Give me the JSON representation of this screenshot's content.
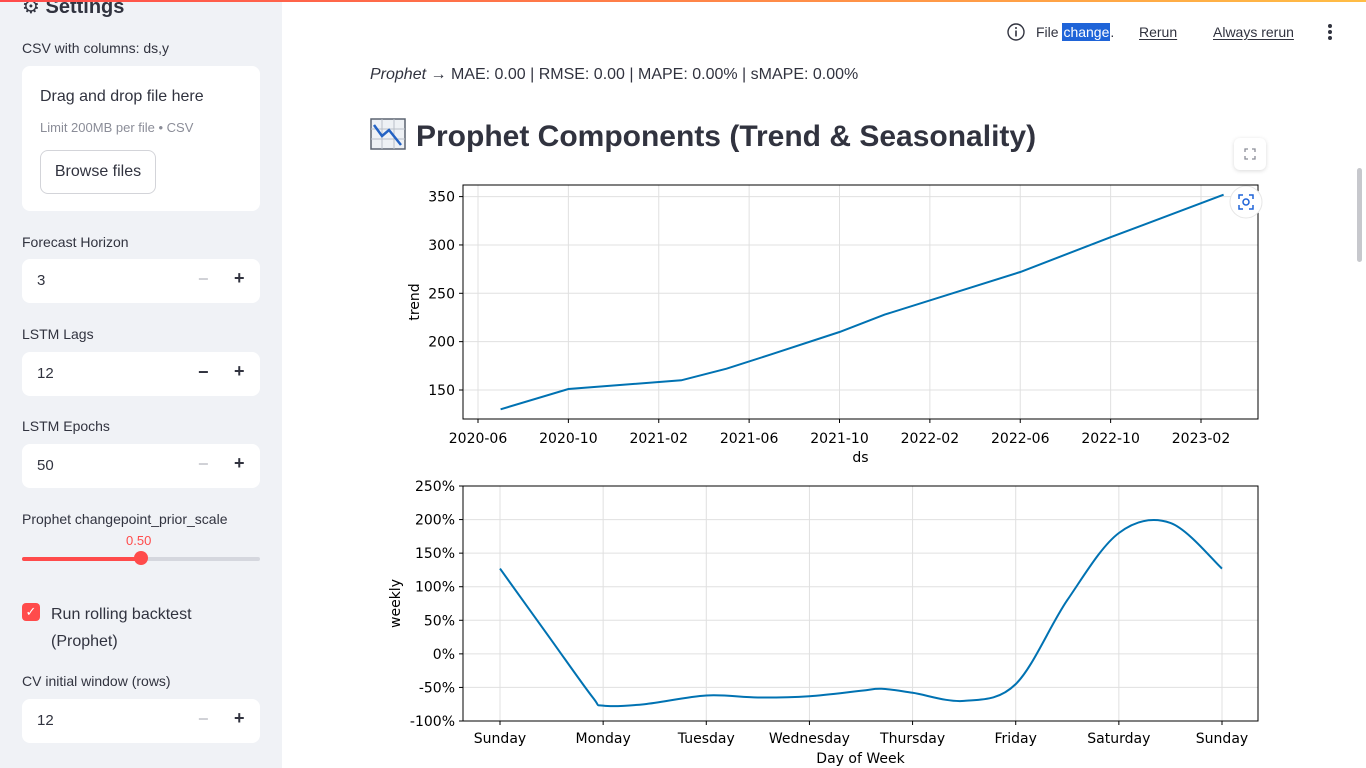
{
  "sidebar": {
    "title": "⚙ Settings",
    "csv_label": "CSV with columns: ds,y",
    "uploader": {
      "main_text": "Drag and drop file here",
      "sub_text": "Limit 200MB per file • CSV",
      "browse_label": "Browse files"
    },
    "forecast_horizon": {
      "label": "Forecast Horizon",
      "value": "3"
    },
    "lstm_lags": {
      "label": "LSTM Lags",
      "value": "12"
    },
    "lstm_epochs": {
      "label": "LSTM Epochs",
      "value": "50"
    },
    "changepoint": {
      "label": "Prophet changepoint_prior_scale",
      "value": "0.50",
      "fraction": 0.5
    },
    "rolling_backtest": {
      "label": "Run rolling backtest (Prophet)",
      "checked": true
    },
    "cv_window": {
      "label": "CV initial window (rows)",
      "value": "12"
    }
  },
  "toolbar": {
    "file_text": "File ",
    "change_text": "change",
    "dot": ".",
    "rerun": "Rerun",
    "always_rerun": "Always rerun"
  },
  "main": {
    "metrics_model": "Prophet",
    "metrics_text": " → MAE: 0.00 | RMSE: 0.00 | MAPE: 0.00% | sMAPE: 0.00%",
    "heading": "Prophet Components (Trend & Seasonality)"
  },
  "colors": {
    "accent": "#ff4b4b",
    "line": "#0072b2"
  },
  "chart_data": [
    {
      "type": "line",
      "xlabel": "ds",
      "ylabel": "trend",
      "x_ticks": [
        "2020-06",
        "2020-10",
        "2021-02",
        "2021-06",
        "2021-10",
        "2022-02",
        "2022-06",
        "2022-10",
        "2023-02"
      ],
      "y_ticks": [
        150,
        200,
        250,
        300,
        350
      ],
      "ylim": [
        120,
        362
      ],
      "x": [
        "2020-07",
        "2020-10",
        "2021-03",
        "2021-05",
        "2021-07",
        "2021-10",
        "2021-12",
        "2022-06",
        "2022-10",
        "2023-03"
      ],
      "y": [
        130,
        151,
        160,
        172,
        187,
        210,
        228,
        272,
        308,
        352
      ],
      "grid": true
    },
    {
      "type": "line",
      "xlabel": "Day of Week",
      "ylabel": "weekly",
      "x_ticks": [
        "Sunday",
        "Monday",
        "Tuesday",
        "Wednesday",
        "Thursday",
        "Friday",
        "Saturday",
        "Sunday"
      ],
      "y_ticks": [
        "-100%",
        "-50%",
        "0%",
        "50%",
        "100%",
        "150%",
        "200%",
        "250%"
      ],
      "ylim": [
        -100,
        250
      ],
      "x": [
        0,
        0.5,
        0.9,
        1.0,
        1.4,
        2.0,
        2.5,
        3.0,
        3.5,
        3.7,
        4.0,
        4.5,
        5.0,
        5.5,
        6.0,
        6.5,
        7.0
      ],
      "y": [
        127,
        20,
        -65,
        -77,
        -75,
        -62,
        -65,
        -63,
        -55,
        -52,
        -58,
        -70,
        -45,
        80,
        180,
        195,
        127
      ],
      "grid": true
    }
  ]
}
